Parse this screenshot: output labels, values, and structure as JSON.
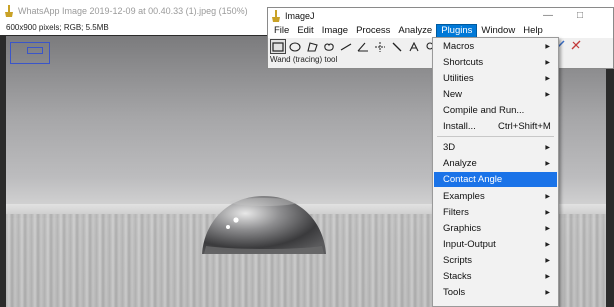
{
  "viewer": {
    "title": "WhatsApp Image 2019-12-09 at 00.40.33 (1).jpeg (150%)",
    "info": "600x900 pixels; RGB; 5.5MB",
    "icon": "imagej-icon"
  },
  "imagej": {
    "title": "ImageJ",
    "icon": "imagej-icon",
    "menubar": [
      "File",
      "Edit",
      "Image",
      "Process",
      "Analyze",
      "Plugins",
      "Window",
      "Help"
    ],
    "active_menu": "Plugins",
    "tools": [
      "rectangle-tool-icon",
      "oval-tool-icon",
      "polygon-tool-icon",
      "freehand-tool-icon",
      "line-tool-icon",
      "angle-tool-icon",
      "point-tool-icon",
      "wand-tool-icon",
      "text-tool-icon",
      "magnifier-tool-icon"
    ],
    "selected_tool": "rectangle-tool-icon",
    "status": "Wand (tracing) tool",
    "window_controls": [
      "minimize-icon",
      "maximize-icon",
      "close-icon"
    ]
  },
  "plugins_menu": {
    "items": [
      {
        "label": "Macros",
        "submenu": true
      },
      {
        "label": "Shortcuts",
        "submenu": true
      },
      {
        "label": "Utilities",
        "submenu": true
      },
      {
        "label": "New",
        "submenu": true
      },
      {
        "label": "Compile and Run...",
        "submenu": false
      },
      {
        "label": "Install...",
        "shortcut": "Ctrl+Shift+M",
        "submenu": false
      },
      {
        "label": "3D",
        "submenu": true
      },
      {
        "label": "Analyze",
        "submenu": true
      },
      {
        "label": "Contact Angle",
        "submenu": false,
        "highlighted": true
      },
      {
        "label": "Examples",
        "submenu": true
      },
      {
        "label": "Filters",
        "submenu": true
      },
      {
        "label": "Graphics",
        "submenu": true
      },
      {
        "label": "Input-Output",
        "submenu": true
      },
      {
        "label": "Scripts",
        "submenu": true
      },
      {
        "label": "Stacks",
        "submenu": true
      },
      {
        "label": "Tools",
        "submenu": true
      }
    ]
  },
  "colors": {
    "highlight": "#1a73e8",
    "active_menu": "#0078d7",
    "zoom_indicator": "#3a55c9"
  }
}
